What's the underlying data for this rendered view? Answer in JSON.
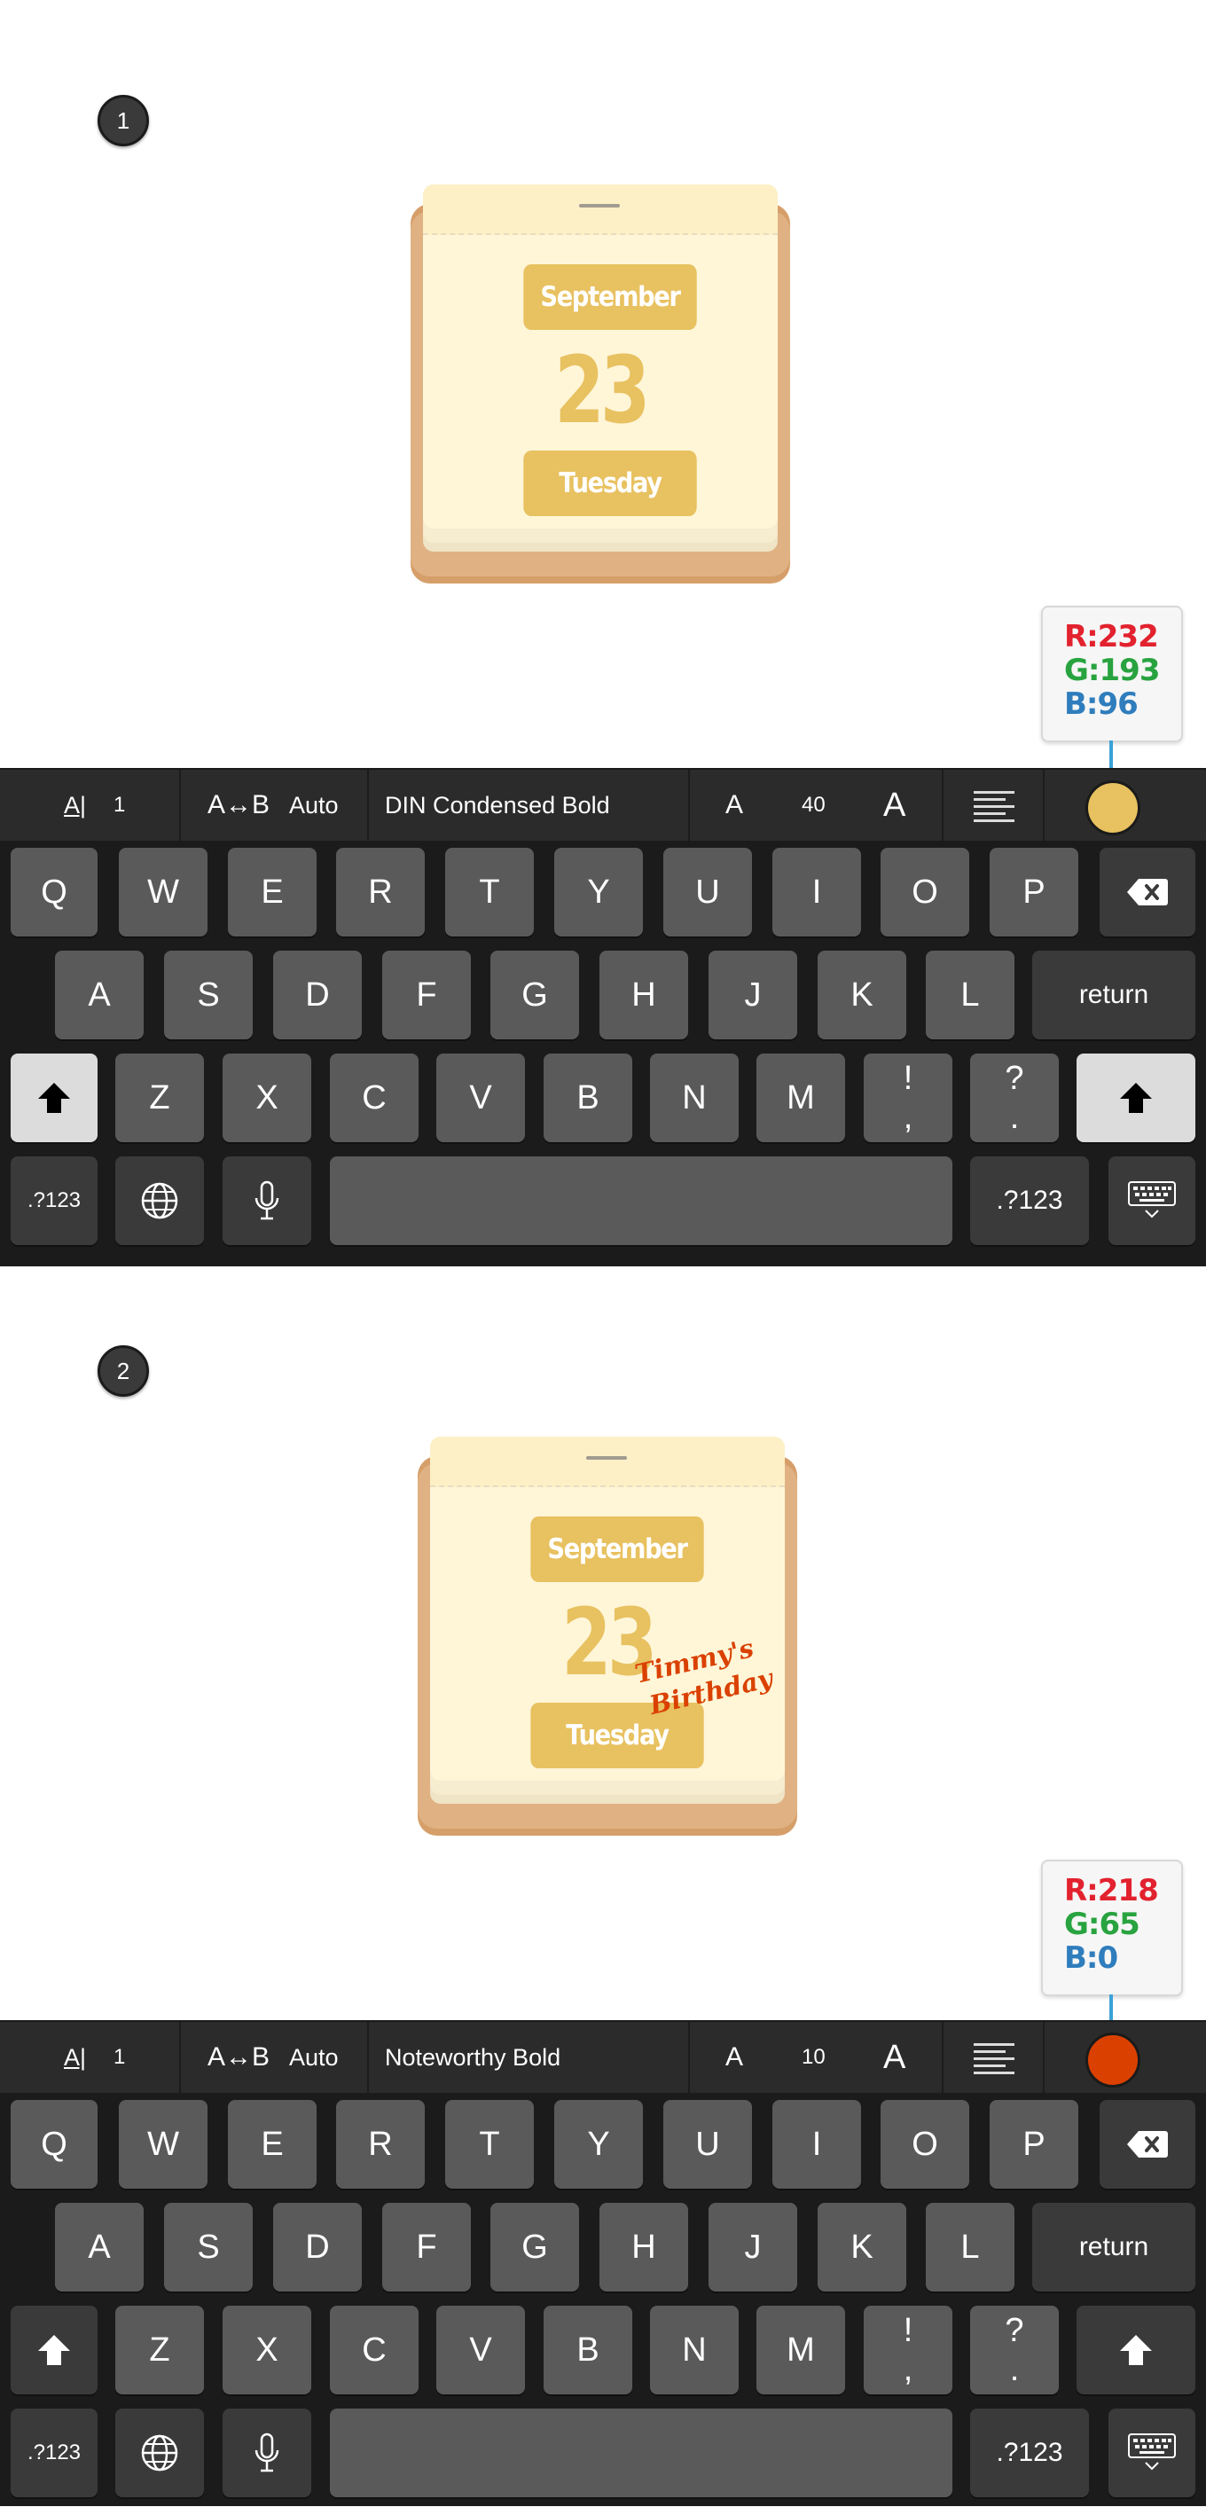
{
  "steps": [
    {
      "number": "1",
      "calendar": {
        "month": "September",
        "day": "23",
        "weekday": "Tuesday",
        "note_line1": "",
        "note_line2": ""
      },
      "color": {
        "r_label": "R:232",
        "g_label": "G:193",
        "b_label": "B:96",
        "hex": "#e8c160"
      },
      "toolbar": {
        "line_spacing_icon": "A|",
        "line_spacing_value": "1",
        "tracking_icon": "A↔B",
        "tracking_value": "Auto",
        "font_name": "DIN Condensed Bold",
        "size_small_icon": "A",
        "font_size": "40",
        "size_large_icon": "A"
      },
      "shift_active": true
    },
    {
      "number": "2",
      "calendar": {
        "month": "September",
        "day": "23",
        "weekday": "Tuesday",
        "note_line1": "Timmy's",
        "note_line2": "Birthday"
      },
      "color": {
        "r_label": "R:218",
        "g_label": "G:65",
        "b_label": "B:0",
        "hex": "#da4100"
      },
      "toolbar": {
        "line_spacing_icon": "A|",
        "line_spacing_value": "1",
        "tracking_icon": "A↔B",
        "tracking_value": "Auto",
        "font_name": "Noteworthy Bold",
        "size_small_icon": "A",
        "font_size": "10",
        "size_large_icon": "A"
      },
      "shift_active": false
    }
  ],
  "keyboard": {
    "row1": [
      "Q",
      "W",
      "E",
      "R",
      "T",
      "Y",
      "U",
      "I",
      "O",
      "P"
    ],
    "row2": [
      "A",
      "S",
      "D",
      "F",
      "G",
      "H",
      "J",
      "K",
      "L"
    ],
    "row3": [
      "Z",
      "X",
      "C",
      "V",
      "B",
      "N",
      "M"
    ],
    "punct1_top": "!",
    "punct1_bottom": ",",
    "punct2_top": "?",
    "punct2_bottom": ".",
    "return_label": "return",
    "numbers_label": ".?123",
    "icons": {
      "backspace": "backspace-icon",
      "shift": "shift-icon",
      "globe": "globe-icon",
      "mic": "microphone-icon",
      "hide": "keyboard-dismiss-icon"
    }
  }
}
